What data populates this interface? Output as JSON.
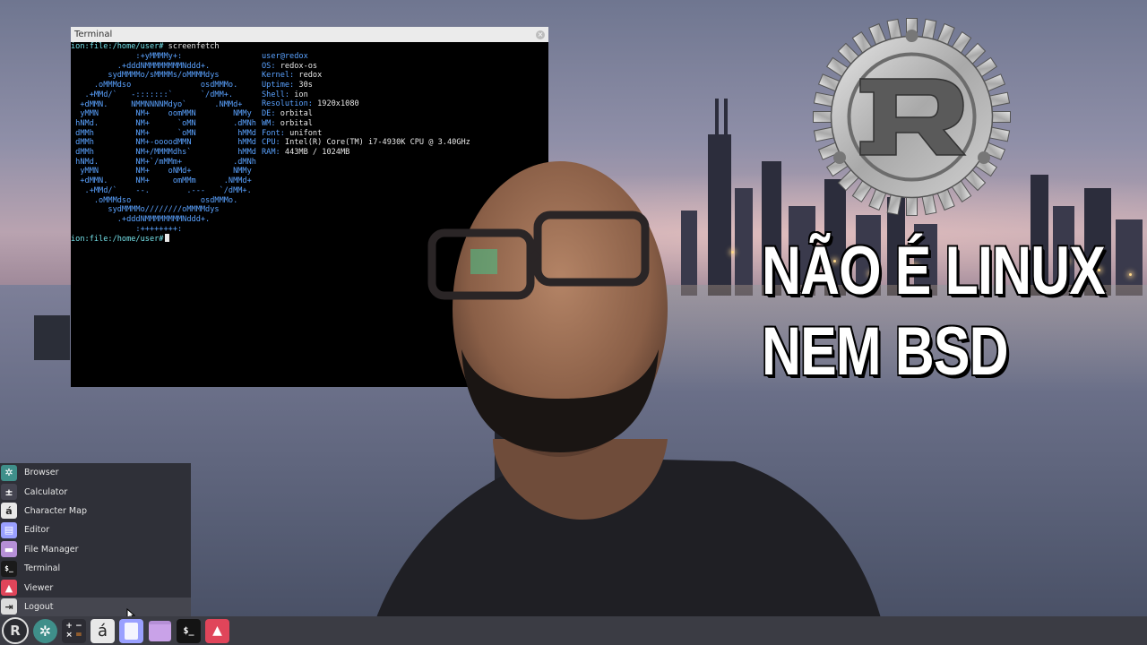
{
  "terminal": {
    "title": "Terminal",
    "close_icon": "close-icon",
    "prompt": "ion:file:/home/user#",
    "command": "screenfetch",
    "logo_lines": [
      "              :+yMMMMy+:",
      "          .+dddNMMMMMMMMNddd+.",
      "        sydMMMMo/sMMMMs/oMMMMdys",
      "     .oMMMdso               osdMMMo.",
      "   .+MMd/`   -:::::::`      `/dMM+.",
      "  +dMMN.     NMMNNNNMdyo`      .NMMd+",
      "  yMMN        NM+    oomMMN        NMMy",
      " hNMd.        NM+      `oMN        .dMNh",
      " dMMh         NM+      `oMN         hMMd",
      " dMMh         NM+-oooodMMN          hMMd",
      " dMMh         NM+/MMMMdhs`          hMMd",
      " hNMd.        NM+`/mMMm+           .dMNh",
      "  yMMN        NM+    oNMd+         NMMy",
      "  +dMMN.      NM+     omMMm      .NMMd+",
      "   .+MMd/`    --.        .---   `/dMM+.",
      "     .oMMMdso               osdMMMo.",
      "        sydMMMMo////////oMMMMdys",
      "          .+dddNMMMMMMMMNddd+.",
      "              :++++++++:"
    ],
    "user_host": "user@redox",
    "info": [
      {
        "key": "OS:",
        "value": "redox-os"
      },
      {
        "key": "Kernel:",
        "value": "redox"
      },
      {
        "key": "Uptime:",
        "value": "30s"
      },
      {
        "key": "Shell:",
        "value": "ion"
      },
      {
        "key": "Resolution:",
        "value": "1920x1080"
      },
      {
        "key": "DE:",
        "value": "orbital"
      },
      {
        "key": "WM:",
        "value": "orbital"
      },
      {
        "key": "Font:",
        "value": "unifont"
      },
      {
        "key": "CPU:",
        "value": "Intel(R) Core(TM) i7-4930K CPU @ 3.40GHz"
      },
      {
        "key": "RAM:",
        "value": "443MB / 1024MB"
      }
    ]
  },
  "headline": {
    "line1": "NÃO É LINUX",
    "line2": "NEM BSD"
  },
  "menu": {
    "items": [
      {
        "label": "Browser",
        "icon": "browser-icon",
        "color": "#3f8f8a"
      },
      {
        "label": "Calculator",
        "icon": "calculator-icon",
        "color": "#444450"
      },
      {
        "label": "Character Map",
        "icon": "character-map-icon",
        "color": "#e8e8e8"
      },
      {
        "label": "Editor",
        "icon": "editor-icon",
        "color": "#9aa0ff"
      },
      {
        "label": "File Manager",
        "icon": "folder-icon",
        "color": "#b58fd6"
      },
      {
        "label": "Terminal",
        "icon": "terminal-icon",
        "color": "#1a1a1a"
      },
      {
        "label": "Viewer",
        "icon": "image-viewer-icon",
        "color": "#e0455a"
      },
      {
        "label": "Logout",
        "icon": "logout-icon",
        "color": "#dcdcdc"
      }
    ],
    "hovered": "Logout"
  },
  "taskbar": {
    "start_label": "R",
    "char_glyph": "á",
    "terminal_glyph": "$_"
  },
  "colors": {
    "terminal_prompt": "#74e0e8",
    "terminal_accent": "#5aa2ff",
    "menu_bg": "#2f3038",
    "taskbar_bg": "#3b3c44"
  }
}
